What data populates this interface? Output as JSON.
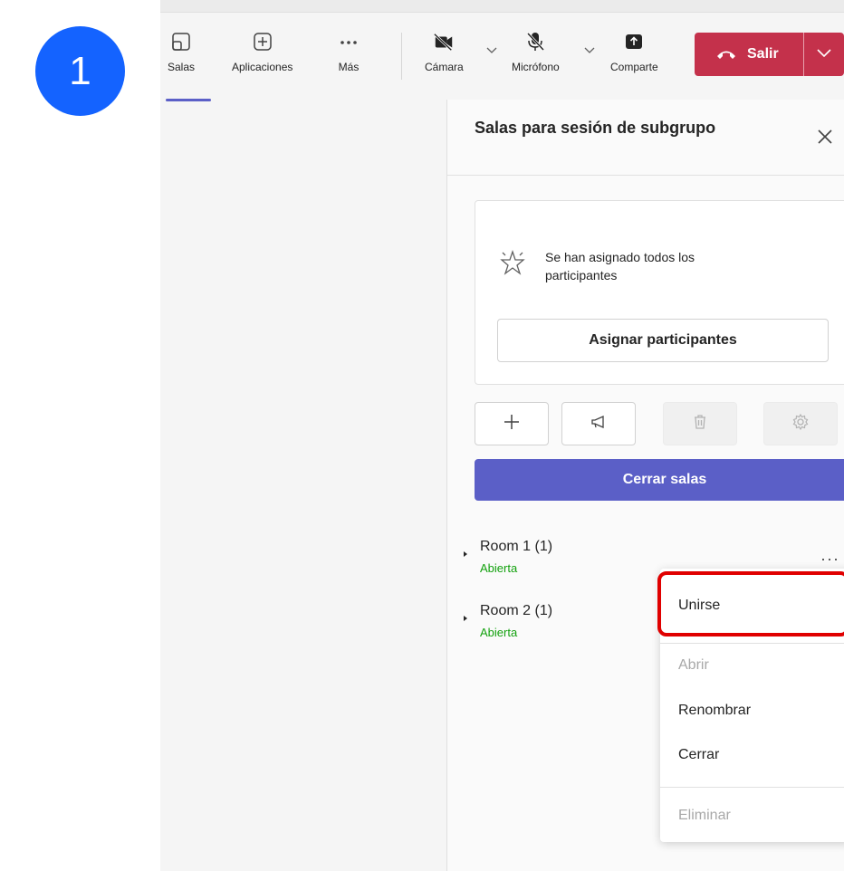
{
  "step_badge": {
    "number": "1",
    "color": "#1463ff"
  },
  "toolbar": {
    "buttons": [
      {
        "label": "Salas",
        "icon": "rooms-icon",
        "active": true
      },
      {
        "label": "Aplicaciones",
        "icon": "add-app-icon"
      },
      {
        "label": "Más",
        "icon": "more-icon"
      },
      {
        "label": "Cámara",
        "icon": "camera-off-icon"
      },
      {
        "label": "Micrófono",
        "icon": "mic-off-icon"
      },
      {
        "label": "Comparte",
        "icon": "share-icon"
      }
    ],
    "leave_label": "Salir",
    "leave_color": "#c4314b"
  },
  "panel": {
    "title": "Salas para sesión de subgrupo",
    "assign_message": "Se han asignado todos los participantes",
    "assign_button": "Asignar participantes",
    "action_buttons": [
      {
        "icon": "add-icon",
        "enabled": true
      },
      {
        "icon": "announce-icon",
        "enabled": true
      },
      {
        "icon": "trash-icon",
        "enabled": false
      },
      {
        "icon": "settings-icon",
        "enabled": false
      }
    ],
    "close_rooms_button": "Cerrar salas",
    "accent_color": "#5b5fc7",
    "rooms": [
      {
        "name": "Room 1",
        "count": "(1)",
        "status": "Abierta"
      },
      {
        "name": "Room 2",
        "count": "(1)",
        "status": "Abierta"
      }
    ]
  },
  "context_menu": {
    "items": [
      {
        "label": "Unirse",
        "enabled": true,
        "highlighted": true
      },
      {
        "label": "Abrir",
        "enabled": false
      },
      {
        "label": "Renombrar",
        "enabled": true
      },
      {
        "label": "Cerrar",
        "enabled": true
      },
      {
        "label": "Eliminar",
        "enabled": false
      }
    ]
  }
}
